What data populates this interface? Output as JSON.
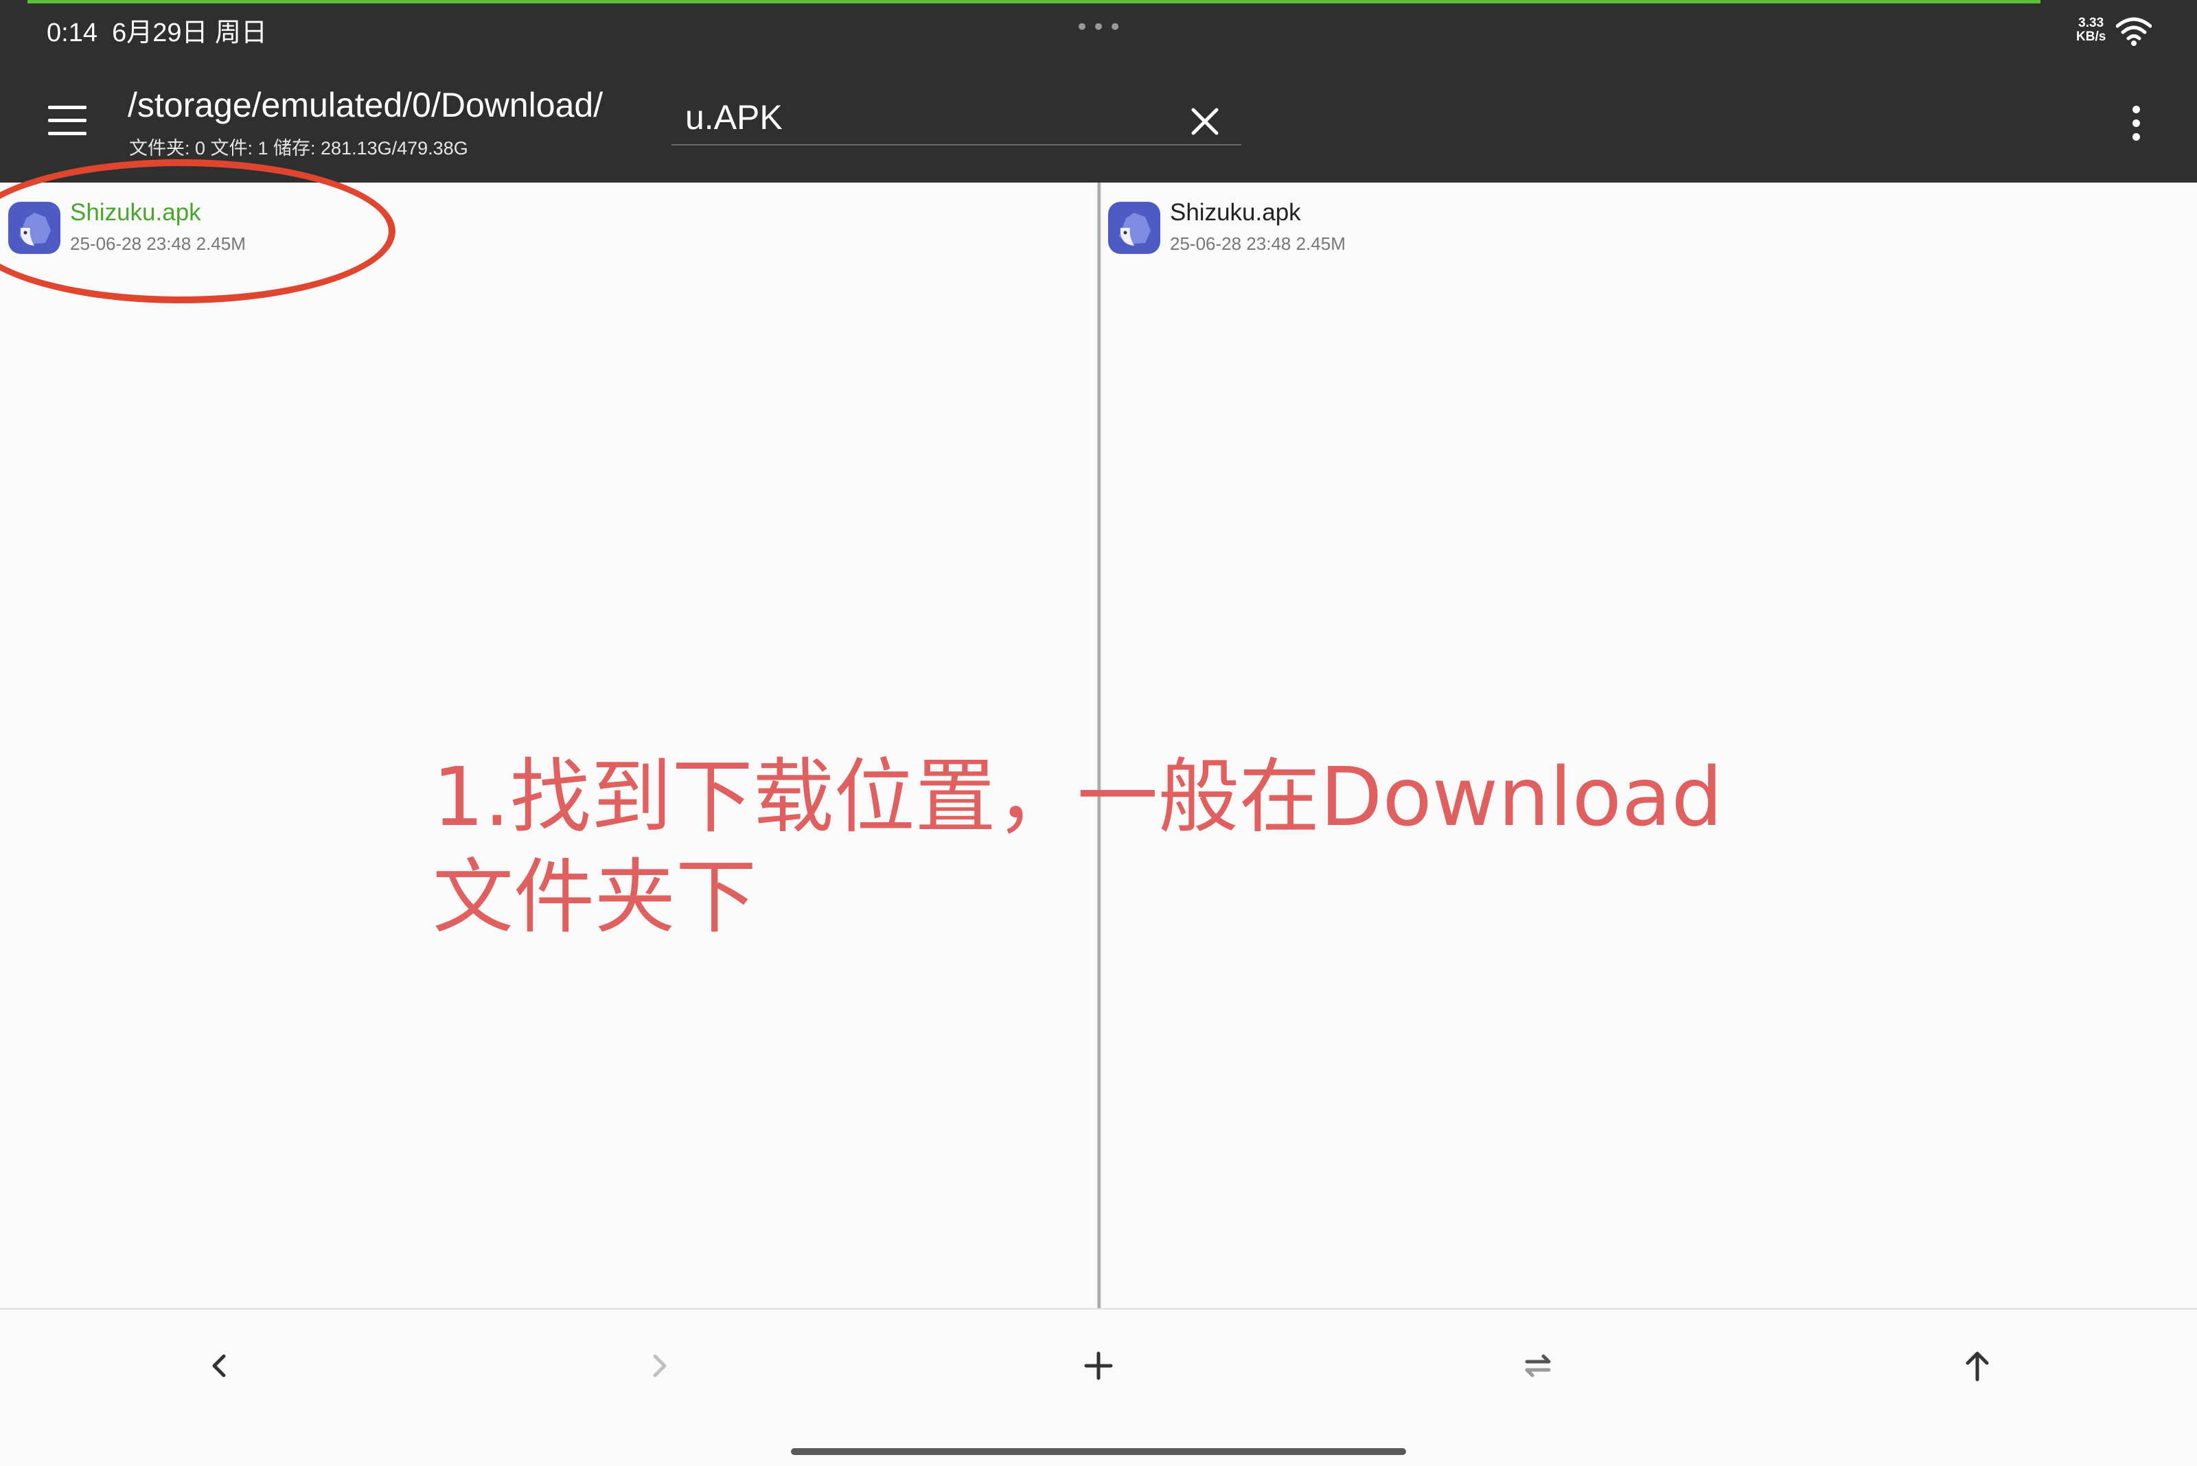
{
  "status_bar": {
    "time": "0:14",
    "date": "6月29日 周日",
    "dots": "•••",
    "net_speed_value": "3.33",
    "net_speed_unit": "KB/s",
    "wifi_icon": "wifi-icon",
    "accent_color": "#5bbf3a"
  },
  "toolbar": {
    "menu_icon": "menu-icon",
    "path": "/storage/emulated/0/Download/",
    "info": "文件夹: 0   文件: 1   储存: 281.13G/479.38G",
    "search_value": "u.APK",
    "clear_icon": "close-icon",
    "overflow_icon": "more-vert-icon"
  },
  "left_pane": {
    "files": [
      {
        "name": "Shizuku.apk",
        "meta": "25-06-28 23:48  2.45M",
        "selected": true
      }
    ]
  },
  "right_pane": {
    "files": [
      {
        "name": "Shizuku.apk",
        "meta": "25-06-28 23:48  2.45M",
        "selected": false
      }
    ]
  },
  "annotation": {
    "text": "1.找到下载位置，一般在Download文件夹下",
    "color": "#e06060",
    "ellipse_color": "#e0452e"
  },
  "bottom_bar": {
    "buttons": [
      "chevron-left-icon",
      "chevron-right-icon",
      "plus-icon",
      "swap-icon",
      "arrow-up-icon"
    ]
  }
}
